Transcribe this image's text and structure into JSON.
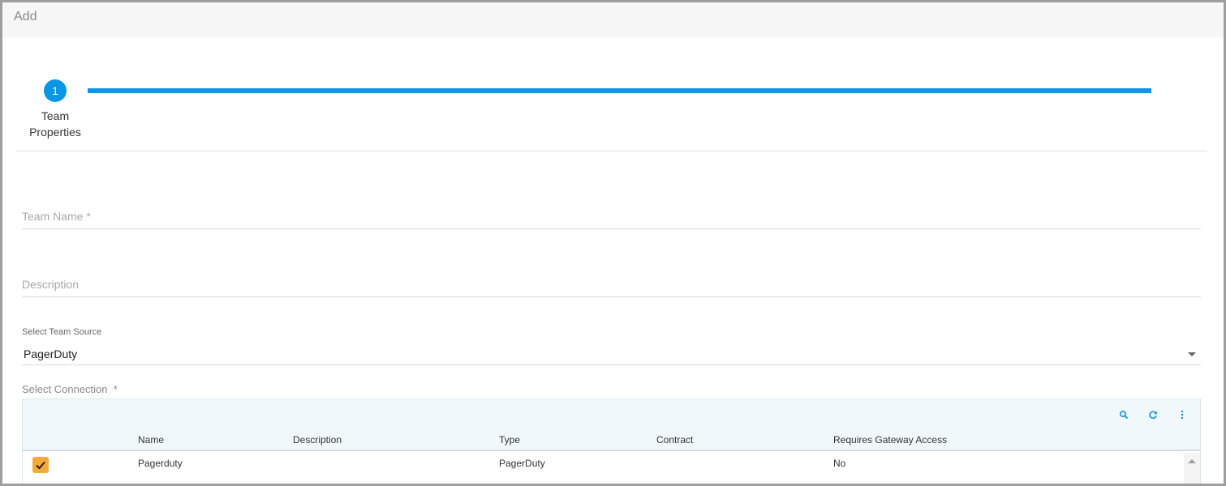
{
  "header": {
    "title": "Add"
  },
  "stepper": {
    "steps": [
      {
        "number": "1",
        "label": "Team Properties",
        "active": true
      }
    ],
    "accent_color": "#0a96e6"
  },
  "form": {
    "team_name": {
      "placeholder": "Team Name *",
      "value": ""
    },
    "description": {
      "placeholder": "Description",
      "value": ""
    },
    "team_source": {
      "label": "Select Team Source",
      "value": "PagerDuty"
    },
    "connection": {
      "label": "Select Connection  *"
    }
  },
  "grid": {
    "toolbar": {
      "icons": [
        "search-icon",
        "refresh-icon",
        "more-vert-icon"
      ]
    },
    "columns": [
      "Name",
      "Description",
      "Type",
      "Contract",
      "Requires Gateway Access"
    ],
    "rows": [
      {
        "selected": true,
        "name": "Pagerduty",
        "description": "",
        "type": "PagerDuty",
        "contract": "",
        "requires_gateway_access": "No"
      }
    ],
    "checkbox_color": "#f5a93b"
  }
}
